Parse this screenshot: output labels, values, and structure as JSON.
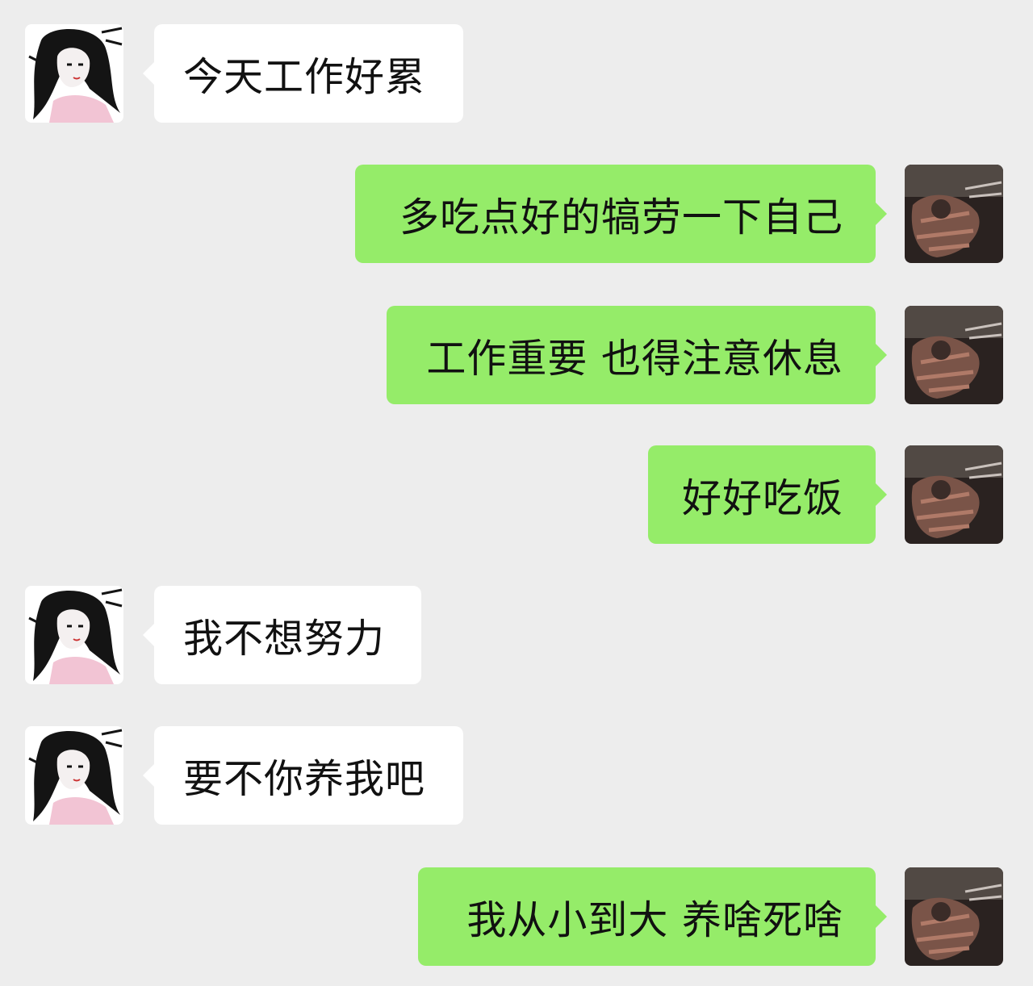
{
  "avatars": {
    "contact": "girl-illustration-avatar",
    "self": "dark-photo-avatar"
  },
  "colors": {
    "background": "#ededed",
    "incoming_bubble": "#ffffff",
    "outgoing_bubble": "#95ec69",
    "text": "#111111"
  },
  "messages": [
    {
      "sender": "contact",
      "text": "今天工作好累"
    },
    {
      "sender": "self",
      "text": "多吃点好的犒劳一下自己"
    },
    {
      "sender": "self",
      "text": "工作重要 也得注意休息"
    },
    {
      "sender": "self",
      "text": "好好吃饭"
    },
    {
      "sender": "contact",
      "text": "我不想努力"
    },
    {
      "sender": "contact",
      "text": "要不你养我吧"
    },
    {
      "sender": "self",
      "text": "我从小到大 养啥死啥"
    }
  ]
}
